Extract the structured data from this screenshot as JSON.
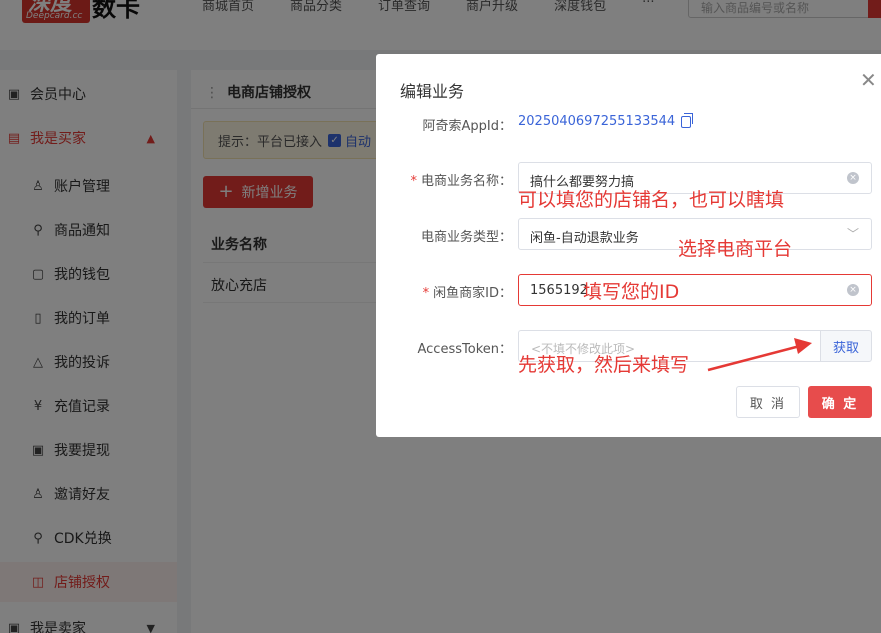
{
  "header": {
    "logo_big": "深度",
    "logo_small": "Deepcard.cc",
    "logo_text": "数卡",
    "nav": [
      "商城首页",
      "商品分类",
      "订单查询",
      "商户升级",
      "深度钱包",
      "···"
    ],
    "search_placeholder": "输入商品编号或名称"
  },
  "sidebar": {
    "member_center": "会员中心",
    "buyer": "我是买家",
    "items": [
      "账户管理",
      "商品通知",
      "我的钱包",
      "我的订单",
      "我的投诉",
      "充值记录",
      "我要提现",
      "邀请好友",
      "CDK兑换",
      "店铺授权"
    ],
    "seller": "我是卖家"
  },
  "main": {
    "title": "电商店铺授权",
    "tip_prefix": "提示：平台已接入",
    "tip_link": "自动",
    "add_button": "新增业务",
    "table_header": "业务名称",
    "row_value": "放心充店"
  },
  "dialog": {
    "title": "编辑业务",
    "appid_label": "阿奇索AppId：",
    "appid_value": "2025040697255133544",
    "name_label": "电商业务名称：",
    "name_value": "搞什么都要努力搞",
    "type_label": "电商业务类型：",
    "type_value": "闲鱼-自动退款业务",
    "merchant_label": "闲鱼商家ID：",
    "merchant_value": "1565192",
    "token_label": "AccessToken：",
    "token_placeholder": "<不填不修改此项>",
    "token_button": "获取",
    "cancel": "取 消",
    "confirm": "确 定"
  },
  "annotations": {
    "name_hint": "可以填您的店铺名，也可以瞎填",
    "type_hint": "选择电商平台",
    "id_hint": "填写您的ID",
    "token_hint": "先获取，然后来填写"
  },
  "colors": {
    "accent": "#e53935",
    "link": "#3a64d8"
  }
}
